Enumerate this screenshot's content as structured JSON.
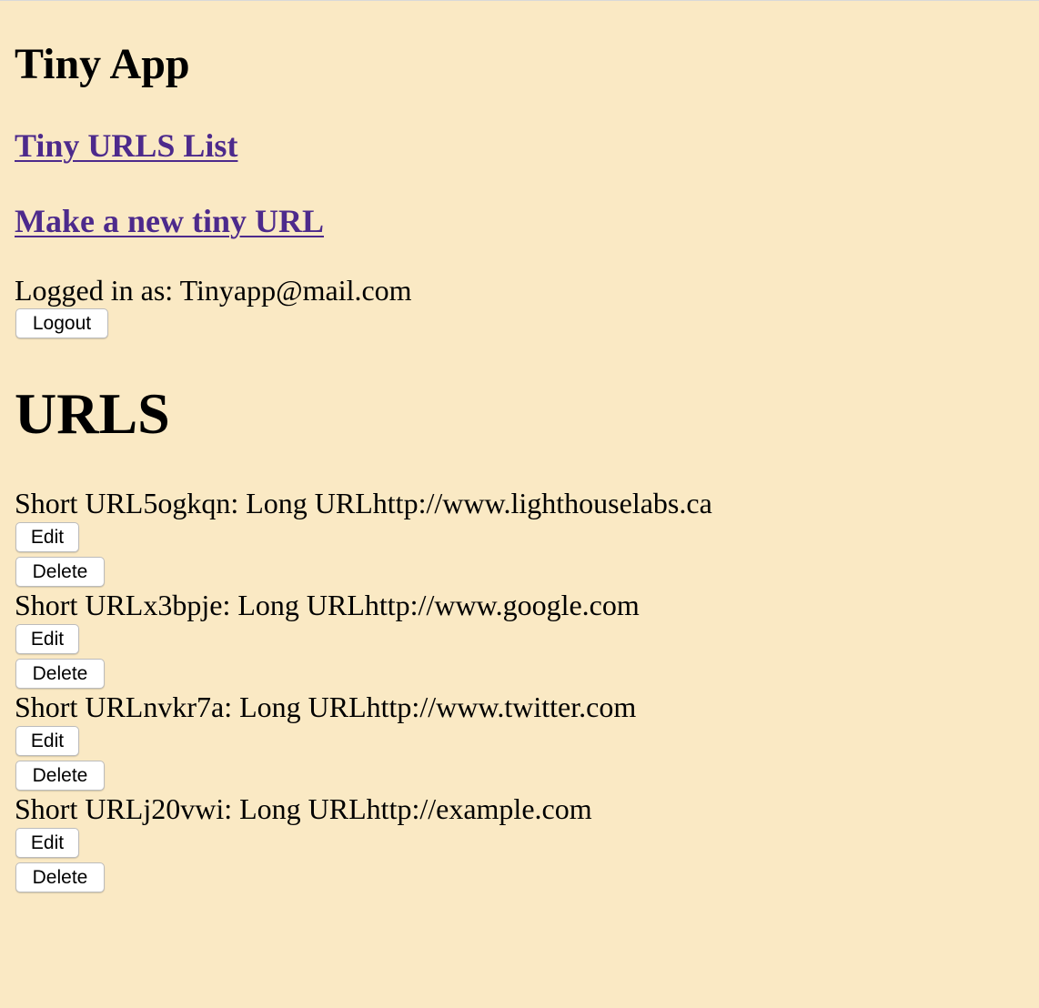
{
  "app": {
    "title": "Tiny App"
  },
  "nav": {
    "urls_list_label": "Tiny URLS List",
    "new_url_label": "Make a new tiny URL"
  },
  "session": {
    "logged_in_prefix": "Logged in as: ",
    "email": "Tinyapp@mail.com",
    "logout_label": "Logout"
  },
  "urls": {
    "heading": "URLS",
    "short_label": "Short URL",
    "long_label": "Long URL",
    "edit_label": "Edit",
    "delete_label": "Delete",
    "items": [
      {
        "short": "5ogkqn",
        "long": "http://www.lighthouselabs.ca"
      },
      {
        "short": "x3bpje",
        "long": "http://www.google.com"
      },
      {
        "short": "nvkr7a",
        "long": "http://www.twitter.com"
      },
      {
        "short": "j20vwi",
        "long": "http://example.com"
      }
    ]
  },
  "colors": {
    "background": "#fae9c4",
    "link": "#4d2a8c"
  }
}
